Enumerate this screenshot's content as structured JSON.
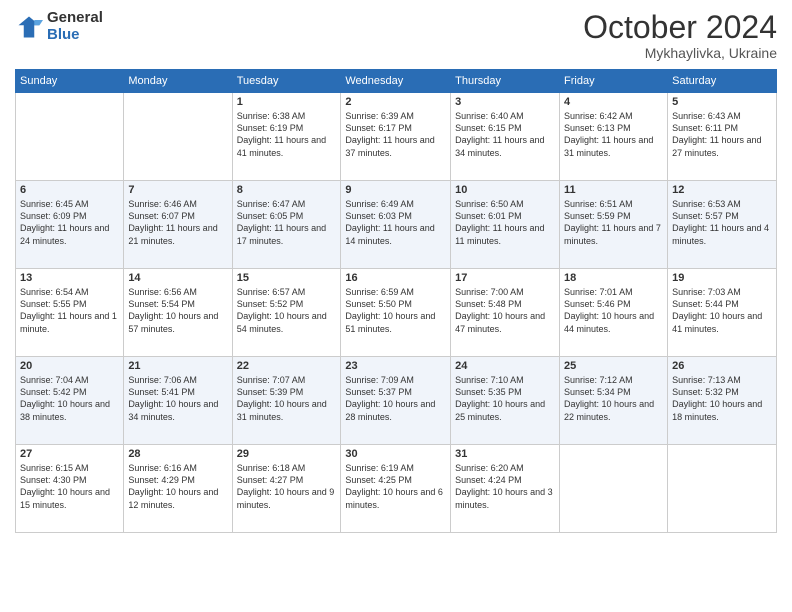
{
  "logo": {
    "general": "General",
    "blue": "Blue"
  },
  "header": {
    "month": "October 2024",
    "location": "Mykhaylivka, Ukraine"
  },
  "weekdays": [
    "Sunday",
    "Monday",
    "Tuesday",
    "Wednesday",
    "Thursday",
    "Friday",
    "Saturday"
  ],
  "weeks": [
    [
      {
        "day": "",
        "sunrise": "",
        "sunset": "",
        "daylight": ""
      },
      {
        "day": "",
        "sunrise": "",
        "sunset": "",
        "daylight": ""
      },
      {
        "day": "1",
        "sunrise": "Sunrise: 6:38 AM",
        "sunset": "Sunset: 6:19 PM",
        "daylight": "Daylight: 11 hours and 41 minutes."
      },
      {
        "day": "2",
        "sunrise": "Sunrise: 6:39 AM",
        "sunset": "Sunset: 6:17 PM",
        "daylight": "Daylight: 11 hours and 37 minutes."
      },
      {
        "day": "3",
        "sunrise": "Sunrise: 6:40 AM",
        "sunset": "Sunset: 6:15 PM",
        "daylight": "Daylight: 11 hours and 34 minutes."
      },
      {
        "day": "4",
        "sunrise": "Sunrise: 6:42 AM",
        "sunset": "Sunset: 6:13 PM",
        "daylight": "Daylight: 11 hours and 31 minutes."
      },
      {
        "day": "5",
        "sunrise": "Sunrise: 6:43 AM",
        "sunset": "Sunset: 6:11 PM",
        "daylight": "Daylight: 11 hours and 27 minutes."
      }
    ],
    [
      {
        "day": "6",
        "sunrise": "Sunrise: 6:45 AM",
        "sunset": "Sunset: 6:09 PM",
        "daylight": "Daylight: 11 hours and 24 minutes."
      },
      {
        "day": "7",
        "sunrise": "Sunrise: 6:46 AM",
        "sunset": "Sunset: 6:07 PM",
        "daylight": "Daylight: 11 hours and 21 minutes."
      },
      {
        "day": "8",
        "sunrise": "Sunrise: 6:47 AM",
        "sunset": "Sunset: 6:05 PM",
        "daylight": "Daylight: 11 hours and 17 minutes."
      },
      {
        "day": "9",
        "sunrise": "Sunrise: 6:49 AM",
        "sunset": "Sunset: 6:03 PM",
        "daylight": "Daylight: 11 hours and 14 minutes."
      },
      {
        "day": "10",
        "sunrise": "Sunrise: 6:50 AM",
        "sunset": "Sunset: 6:01 PM",
        "daylight": "Daylight: 11 hours and 11 minutes."
      },
      {
        "day": "11",
        "sunrise": "Sunrise: 6:51 AM",
        "sunset": "Sunset: 5:59 PM",
        "daylight": "Daylight: 11 hours and 7 minutes."
      },
      {
        "day": "12",
        "sunrise": "Sunrise: 6:53 AM",
        "sunset": "Sunset: 5:57 PM",
        "daylight": "Daylight: 11 hours and 4 minutes."
      }
    ],
    [
      {
        "day": "13",
        "sunrise": "Sunrise: 6:54 AM",
        "sunset": "Sunset: 5:55 PM",
        "daylight": "Daylight: 11 hours and 1 minute."
      },
      {
        "day": "14",
        "sunrise": "Sunrise: 6:56 AM",
        "sunset": "Sunset: 5:54 PM",
        "daylight": "Daylight: 10 hours and 57 minutes."
      },
      {
        "day": "15",
        "sunrise": "Sunrise: 6:57 AM",
        "sunset": "Sunset: 5:52 PM",
        "daylight": "Daylight: 10 hours and 54 minutes."
      },
      {
        "day": "16",
        "sunrise": "Sunrise: 6:59 AM",
        "sunset": "Sunset: 5:50 PM",
        "daylight": "Daylight: 10 hours and 51 minutes."
      },
      {
        "day": "17",
        "sunrise": "Sunrise: 7:00 AM",
        "sunset": "Sunset: 5:48 PM",
        "daylight": "Daylight: 10 hours and 47 minutes."
      },
      {
        "day": "18",
        "sunrise": "Sunrise: 7:01 AM",
        "sunset": "Sunset: 5:46 PM",
        "daylight": "Daylight: 10 hours and 44 minutes."
      },
      {
        "day": "19",
        "sunrise": "Sunrise: 7:03 AM",
        "sunset": "Sunset: 5:44 PM",
        "daylight": "Daylight: 10 hours and 41 minutes."
      }
    ],
    [
      {
        "day": "20",
        "sunrise": "Sunrise: 7:04 AM",
        "sunset": "Sunset: 5:42 PM",
        "daylight": "Daylight: 10 hours and 38 minutes."
      },
      {
        "day": "21",
        "sunrise": "Sunrise: 7:06 AM",
        "sunset": "Sunset: 5:41 PM",
        "daylight": "Daylight: 10 hours and 34 minutes."
      },
      {
        "day": "22",
        "sunrise": "Sunrise: 7:07 AM",
        "sunset": "Sunset: 5:39 PM",
        "daylight": "Daylight: 10 hours and 31 minutes."
      },
      {
        "day": "23",
        "sunrise": "Sunrise: 7:09 AM",
        "sunset": "Sunset: 5:37 PM",
        "daylight": "Daylight: 10 hours and 28 minutes."
      },
      {
        "day": "24",
        "sunrise": "Sunrise: 7:10 AM",
        "sunset": "Sunset: 5:35 PM",
        "daylight": "Daylight: 10 hours and 25 minutes."
      },
      {
        "day": "25",
        "sunrise": "Sunrise: 7:12 AM",
        "sunset": "Sunset: 5:34 PM",
        "daylight": "Daylight: 10 hours and 22 minutes."
      },
      {
        "day": "26",
        "sunrise": "Sunrise: 7:13 AM",
        "sunset": "Sunset: 5:32 PM",
        "daylight": "Daylight: 10 hours and 18 minutes."
      }
    ],
    [
      {
        "day": "27",
        "sunrise": "Sunrise: 6:15 AM",
        "sunset": "Sunset: 4:30 PM",
        "daylight": "Daylight: 10 hours and 15 minutes."
      },
      {
        "day": "28",
        "sunrise": "Sunrise: 6:16 AM",
        "sunset": "Sunset: 4:29 PM",
        "daylight": "Daylight: 10 hours and 12 minutes."
      },
      {
        "day": "29",
        "sunrise": "Sunrise: 6:18 AM",
        "sunset": "Sunset: 4:27 PM",
        "daylight": "Daylight: 10 hours and 9 minutes."
      },
      {
        "day": "30",
        "sunrise": "Sunrise: 6:19 AM",
        "sunset": "Sunset: 4:25 PM",
        "daylight": "Daylight: 10 hours and 6 minutes."
      },
      {
        "day": "31",
        "sunrise": "Sunrise: 6:20 AM",
        "sunset": "Sunset: 4:24 PM",
        "daylight": "Daylight: 10 hours and 3 minutes."
      },
      {
        "day": "",
        "sunrise": "",
        "sunset": "",
        "daylight": ""
      },
      {
        "day": "",
        "sunrise": "",
        "sunset": "",
        "daylight": ""
      }
    ]
  ]
}
